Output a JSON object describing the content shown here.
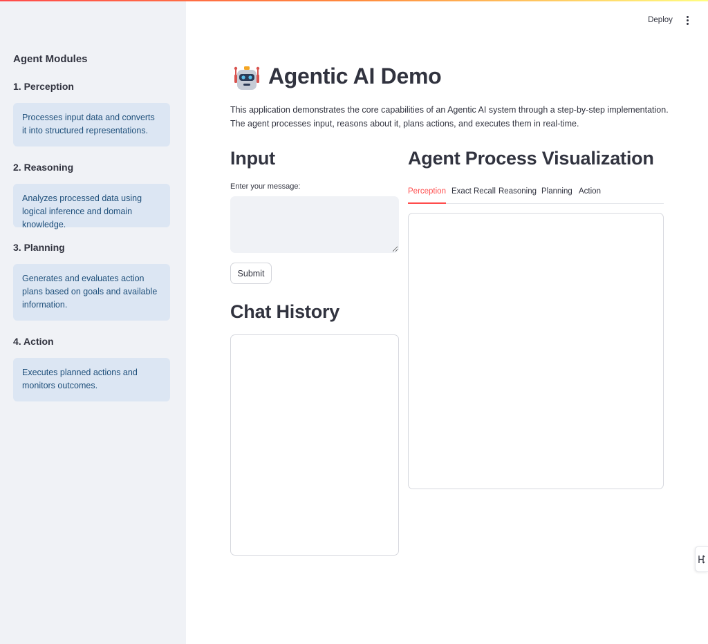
{
  "header": {
    "deploy_label": "Deploy"
  },
  "sidebar": {
    "title": "Agent Modules",
    "modules": [
      {
        "heading": "1. Perception",
        "description": "Processes input data and converts it into structured representations."
      },
      {
        "heading": "2. Reasoning",
        "description": "Analyzes processed data using logical inference and domain knowledge."
      },
      {
        "heading": "3. Planning",
        "description": "Generates and evaluates action plans based on goals and available information."
      },
      {
        "heading": "4. Action",
        "description": "Executes planned actions and monitors outcomes."
      }
    ]
  },
  "main": {
    "title": "Agentic AI Demo",
    "title_icon": "robot-icon",
    "intro": "This application demonstrates the core capabilities of an Agentic AI system through a step-by-step implementation. The agent processes input, reasons about it, plans actions, and executes them in real-time.",
    "input": {
      "heading": "Input",
      "label": "Enter your message:",
      "value": "",
      "submit_label": "Submit"
    },
    "chat": {
      "heading": "Chat History"
    },
    "visualization": {
      "heading": "Agent Process Visualization",
      "tabs": [
        "Perception",
        "Exact Recall",
        "Reasoning",
        "Planning",
        "Action"
      ],
      "active_tab": "Perception"
    }
  },
  "colors": {
    "accent": "#ff4b4b",
    "sidebar_bg": "#f0f2f6",
    "card_bg": "#dce6f3",
    "card_text": "#1e4f7a",
    "text": "#31333f"
  }
}
